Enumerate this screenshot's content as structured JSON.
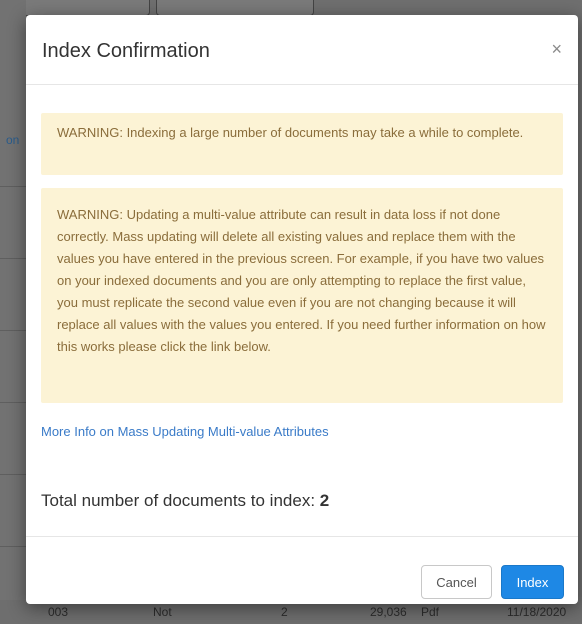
{
  "background": {
    "left_link_fragment": "on",
    "bottom_row": {
      "id": "003",
      "status": "Not",
      "count": "2",
      "size": "29,036",
      "type": "Pdf",
      "date": "11/18/2020"
    }
  },
  "modal": {
    "title": "Index Confirmation",
    "close_symbol": "×",
    "warning_1": "WARNING: Indexing a large number of documents may take a while to complete.",
    "warning_2": "WARNING: Updating a multi-value attribute can result in data loss if not done correctly. Mass updating will delete all existing values and replace them with the values you have entered in the previous screen. For example, if you have two values on your indexed documents and you are only attempting to replace the first value, you must replicate the second value even if you are not changing because it will replace all values with the values you entered. If you need further information on how this works please click the link below.",
    "more_info_link": "More Info on Mass Updating Multi-value Attributes",
    "total_label": "Total number of documents to index:",
    "total_count": "2",
    "cancel_label": "Cancel",
    "index_label": "Index"
  },
  "colors": {
    "warning_bg": "#fcf3d5",
    "warning_text": "#8a6d3b",
    "link": "#3a7bc8",
    "primary": "#1e88e5",
    "overlay": "#6f6f6f"
  }
}
